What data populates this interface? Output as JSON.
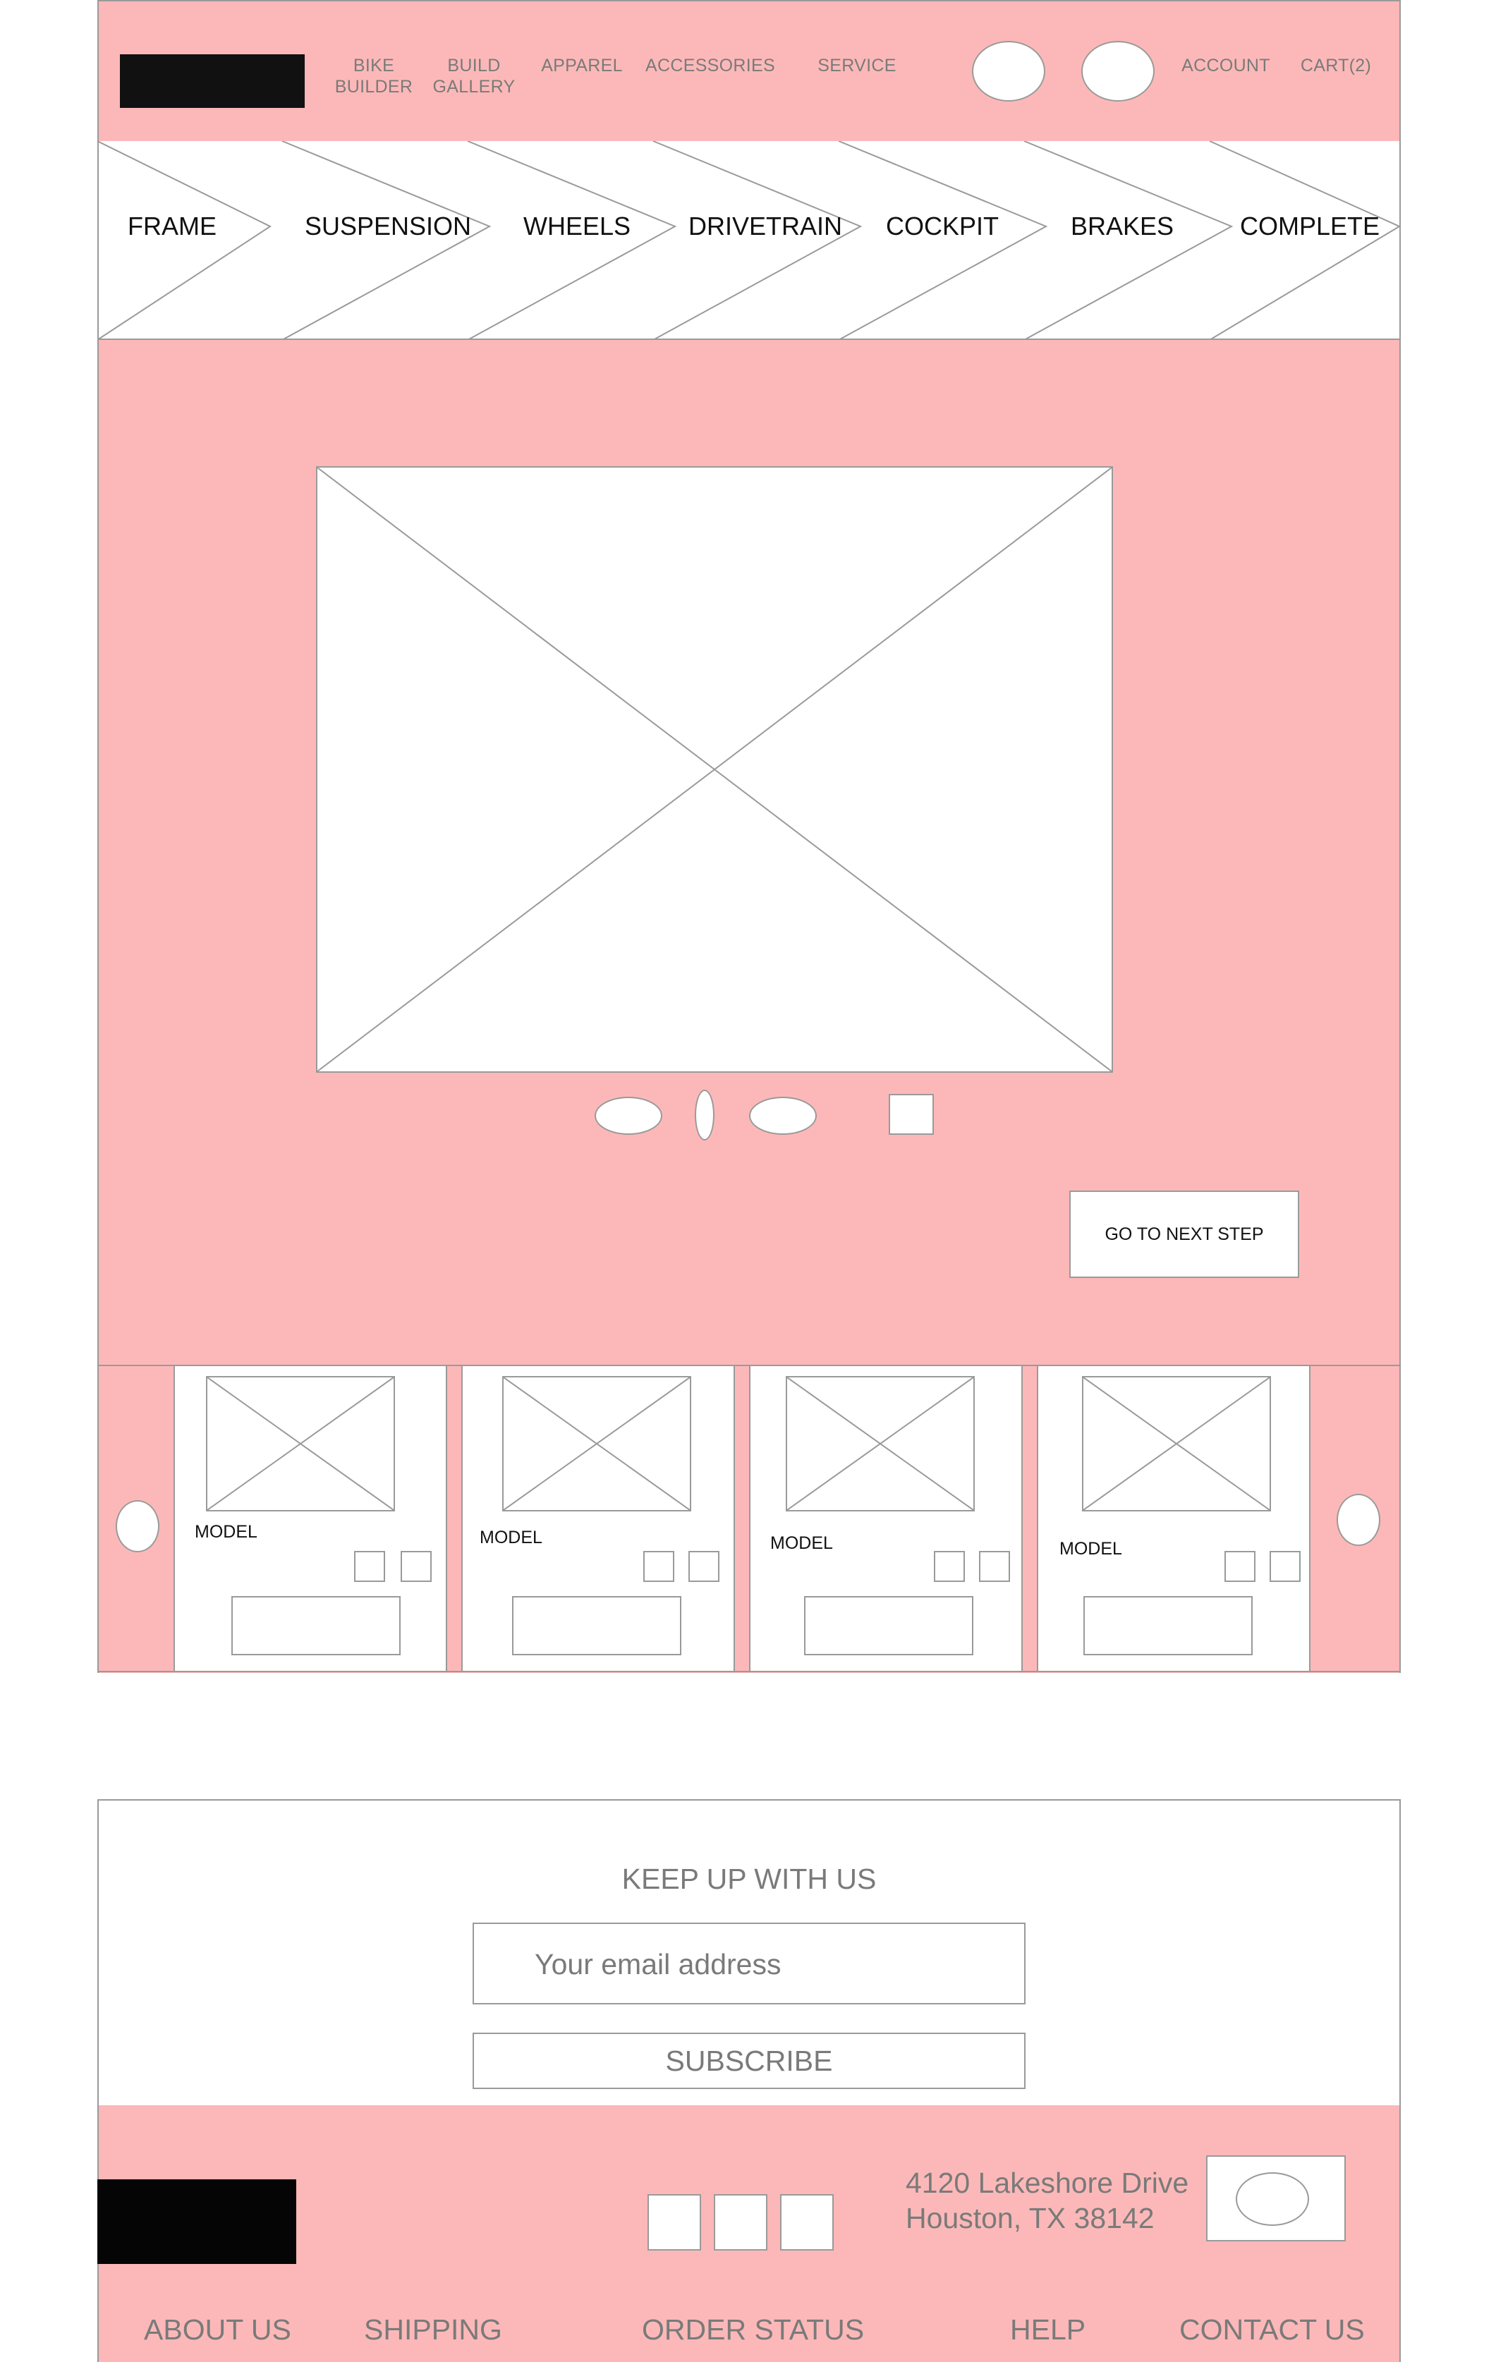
{
  "header": {
    "nav": [
      {
        "line1": "BIKE",
        "line2": "BUILDER"
      },
      {
        "line1": "BUILD",
        "line2": "GALLERY"
      },
      {
        "line1": "APPAREL",
        "line2": ""
      },
      {
        "line1": "ACCESSORIES",
        "line2": ""
      },
      {
        "line1": "SERVICE",
        "line2": ""
      }
    ],
    "account_label": "ACCOUNT",
    "cart_label": "CART(2)"
  },
  "steps": [
    "FRAME",
    "SUSPENSION",
    "WHEELS",
    "DRIVETRAIN",
    "COCKPIT",
    "BRAKES",
    "COMPLETE"
  ],
  "builder": {
    "next_step_label": "GO TO NEXT STEP"
  },
  "products": [
    {
      "model": "MODEL"
    },
    {
      "model": "MODEL"
    },
    {
      "model": "MODEL"
    },
    {
      "model": "MODEL"
    }
  ],
  "newsletter": {
    "heading": "KEEP UP WITH US",
    "email_placeholder": "Your email address",
    "subscribe_label": "SUBSCRIBE"
  },
  "footer": {
    "address_line1": "4120 Lakeshore Drive",
    "address_line2": "Houston, TX 38142",
    "links": [
      "ABOUT US",
      "SHIPPING",
      "ORDER STATUS",
      "HELP",
      "CONTACT US"
    ]
  },
  "colors": {
    "page_accent": "#fcb8b8",
    "wireframe_stroke": "#9a9a9a",
    "logo_block": "#111111"
  },
  "icons": [
    "logo-placeholder",
    "search-icon-placeholder",
    "user-icon-placeholder",
    "image-placeholder",
    "arrow-left-icon",
    "arrow-right-icon",
    "social-icon",
    "payment-badge"
  ]
}
